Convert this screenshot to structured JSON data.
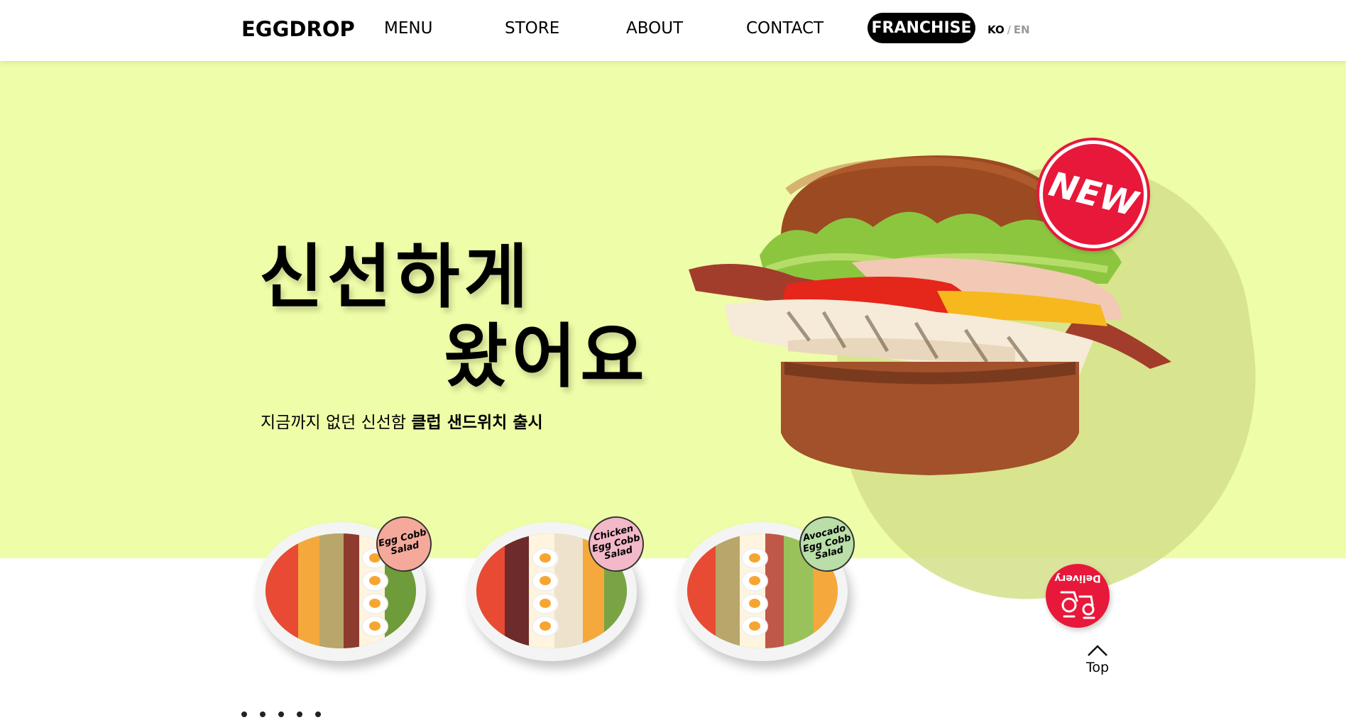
{
  "header": {
    "logo": "EGGDROP",
    "nav": [
      "MENU",
      "STORE",
      "ABOUT",
      "CONTACT"
    ],
    "franchise": "FRANCHISE",
    "lang": {
      "ko": "KO",
      "separator": "/",
      "en": "EN"
    }
  },
  "hero": {
    "headline_line1": "신선하게",
    "headline_line2": "왔어요",
    "subline_regular": "지금까지 없던 신선함 ",
    "subline_bold": "클럽 샌드위치 출시",
    "new_badge": "NEW",
    "background_color": "#eefda8"
  },
  "salads": [
    {
      "badge": "Egg Cobb Salad",
      "badge_color": "#f5a99b"
    },
    {
      "badge": "Chicken Egg Cobb Salad",
      "badge_color": "#f3b9c9"
    },
    {
      "badge": "Avocado Egg Cobb Salad",
      "badge_color": "#b9dea8"
    }
  ],
  "floating": {
    "delivery": "Delivery",
    "top": "Top"
  },
  "colors": {
    "accent_red": "#e8183b",
    "hero_bg": "#eefda8"
  },
  "icons": [
    "delivery-icon",
    "arrow-up-icon",
    "new-badge"
  ]
}
